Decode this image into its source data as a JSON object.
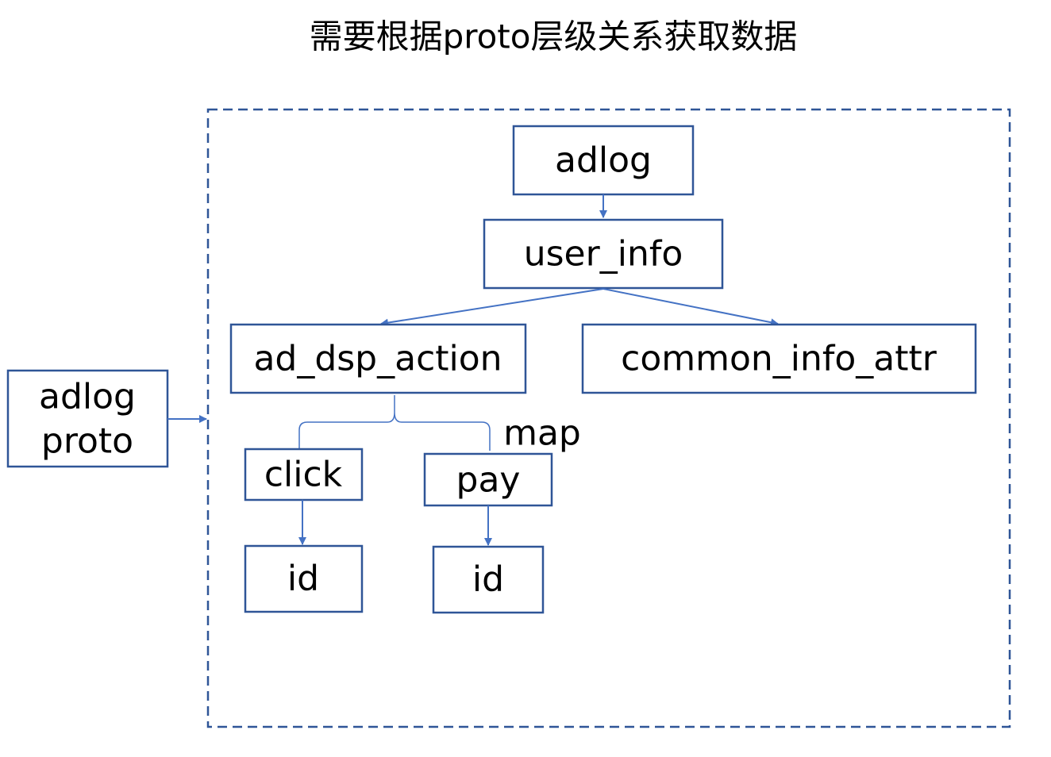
{
  "title": "需要根据proto层级关系获取数据",
  "nodes": {
    "adlog_proto": {
      "line1": "adlog",
      "line2": "proto"
    },
    "adlog": "adlog",
    "user_info": "user_info",
    "ad_dsp_action": "ad_dsp_action",
    "common_info_attr": "common_info_attr",
    "click": "click",
    "pay": "pay",
    "click_id": "id",
    "pay_id": "id"
  },
  "labels": {
    "map": "map"
  },
  "colors": {
    "box_border": "#2f5597",
    "arrow": "#4472c4",
    "text": "#000000"
  }
}
